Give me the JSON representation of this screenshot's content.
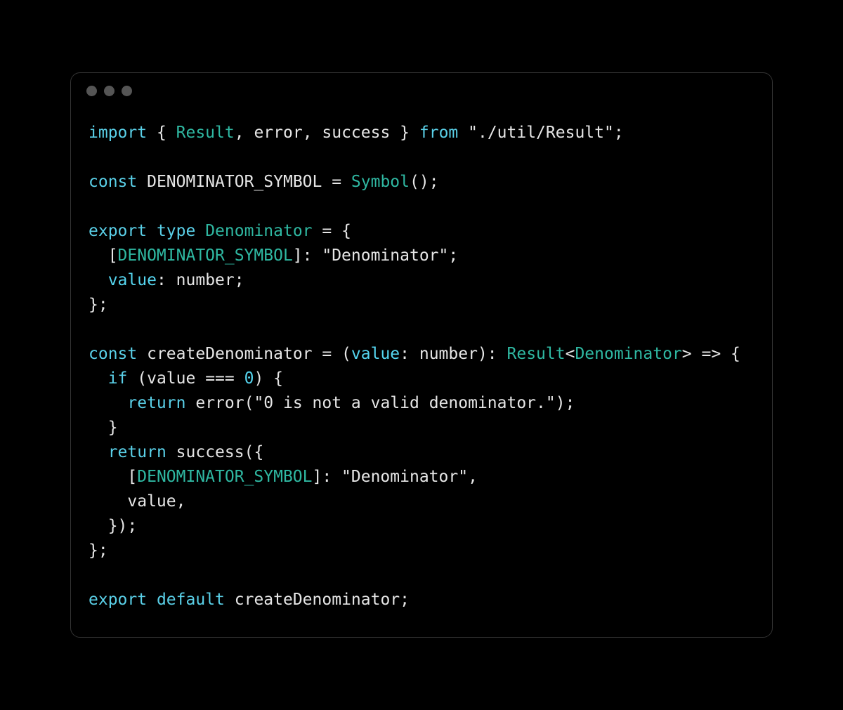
{
  "titlebar": {
    "dots": 3
  },
  "code": {
    "line1": {
      "import": "import",
      "lbrace": " { ",
      "Result": "Result",
      "comma1": ", ",
      "error": "error",
      "comma2": ", ",
      "success": "success",
      "rbrace": " } ",
      "from": "from",
      "space": " ",
      "path": "\"./util/Result\"",
      "semi": ";"
    },
    "line3": {
      "const": "const",
      "space": " ",
      "name": "DENOMINATOR_SYMBOL",
      "eq": " = ",
      "Symbol": "Symbol",
      "parens": "();"
    },
    "line5": {
      "export": "export",
      "space1": " ",
      "type": "type",
      "space2": " ",
      "name": "Denominator",
      "eq": " = {"
    },
    "line6": {
      "indent": "  [",
      "symbol": "DENOMINATOR_SYMBOL",
      "close": "]: ",
      "str": "\"Denominator\"",
      "semi": ";"
    },
    "line7": {
      "indent": "  ",
      "prop": "value",
      "colon": ": ",
      "typ": "number",
      "semi": ";"
    },
    "line8": {
      "close": "};"
    },
    "line10": {
      "const": "const",
      "space": " ",
      "name": "createDenominator",
      "eq": " = (",
      "param": "value",
      "colon": ": ",
      "ptype": "number",
      "close": "): ",
      "rtype": "Result",
      "lt": "<",
      "gtype": "Denominator",
      "gt": ">",
      "arrow": " => {"
    },
    "line11": {
      "indent": "  ",
      "if": "if",
      "space": " (",
      "var": "value",
      "op": " === ",
      "zero": "0",
      "close": ") {"
    },
    "line12": {
      "indent": "    ",
      "return": "return",
      "space": " ",
      "error": "error",
      "open": "(",
      "msg": "\"0 is not a valid denominator.\"",
      "close": ");"
    },
    "line13": {
      "close": "  }"
    },
    "line14": {
      "indent": "  ",
      "return": "return",
      "space": " ",
      "success": "success",
      "open": "({"
    },
    "line15": {
      "indent": "    [",
      "symbol": "DENOMINATOR_SYMBOL",
      "close": "]: ",
      "str": "\"Denominator\"",
      "comma": ","
    },
    "line16": {
      "indent": "    ",
      "val": "value",
      "comma": ","
    },
    "line17": {
      "close": "  });"
    },
    "line18": {
      "close": "};"
    },
    "line20": {
      "export": "export",
      "space1": " ",
      "default": "default",
      "space2": " ",
      "name": "createDenominator",
      "semi": ";"
    }
  }
}
